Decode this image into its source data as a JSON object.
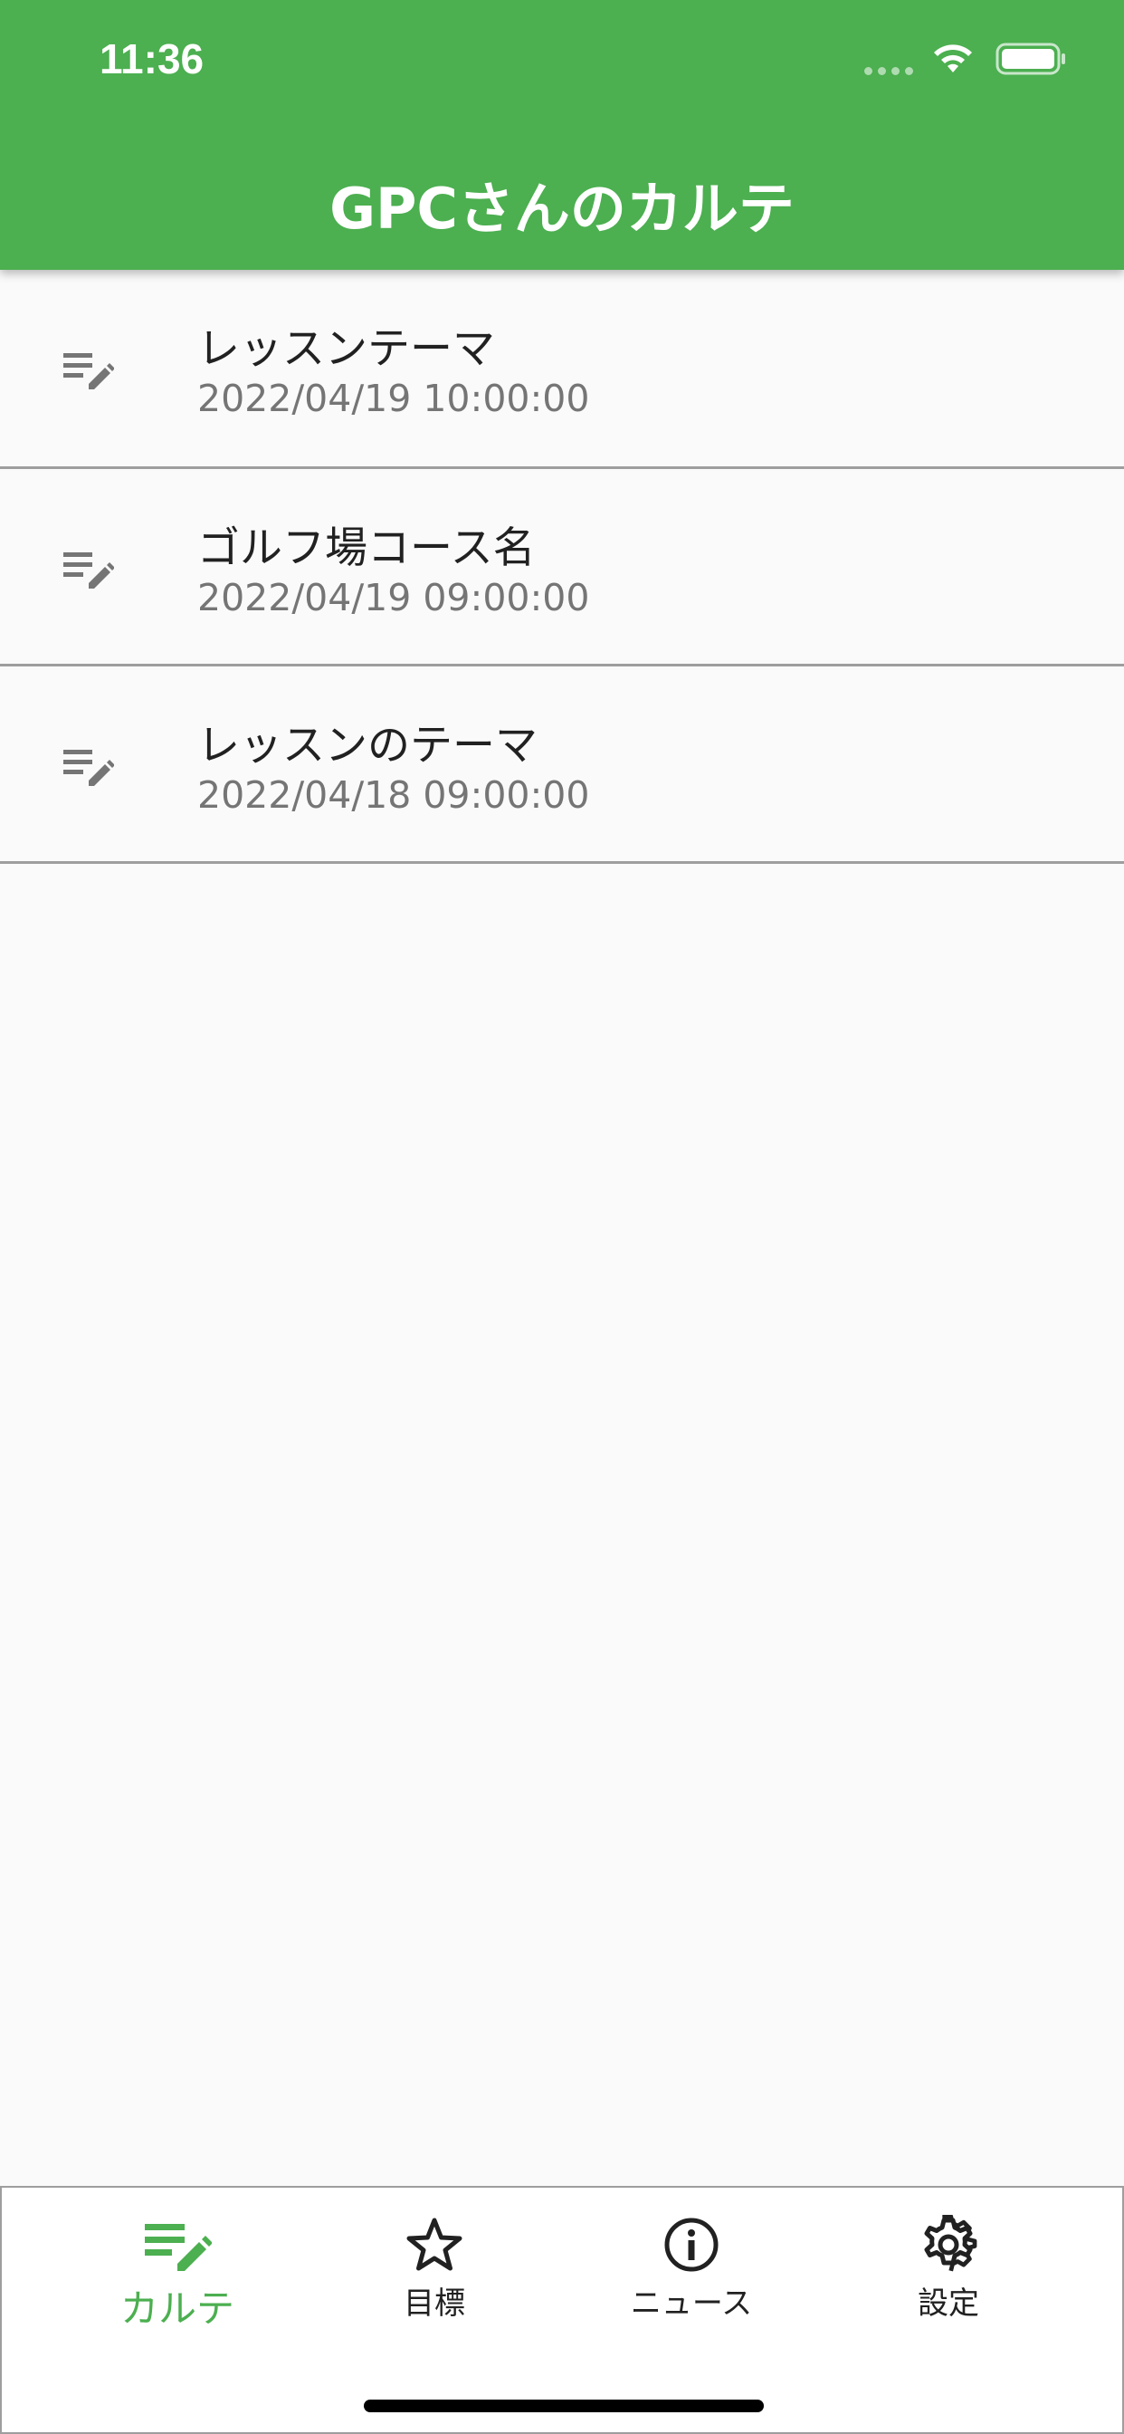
{
  "status_bar": {
    "time": "11:36"
  },
  "header": {
    "title": "GPCさんのカルテ"
  },
  "karte_list": [
    {
      "title": "レッスンテーマ",
      "date": "2022/04/19 10:00:00",
      "icon": "edit-note-icon"
    },
    {
      "title": "ゴルフ場コース名",
      "date": "2022/04/19 09:00:00",
      "icon": "edit-note-icon"
    },
    {
      "title": "レッスンのテーマ",
      "date": "2022/04/18 09:00:00",
      "icon": "edit-note-icon"
    }
  ],
  "bottom_nav": {
    "items": [
      {
        "label": "カルテ",
        "icon": "edit-note-icon",
        "active": true
      },
      {
        "label": "目標",
        "icon": "star-outline-icon",
        "active": false
      },
      {
        "label": "ニュース",
        "icon": "info-icon",
        "active": false
      },
      {
        "label": "設定",
        "icon": "gear-icon",
        "active": false
      }
    ]
  },
  "colors": {
    "primary": "#4caf50",
    "text_primary": "#212121",
    "text_secondary": "#757575",
    "divider": "#9e9e9e",
    "background": "#fafafa"
  }
}
